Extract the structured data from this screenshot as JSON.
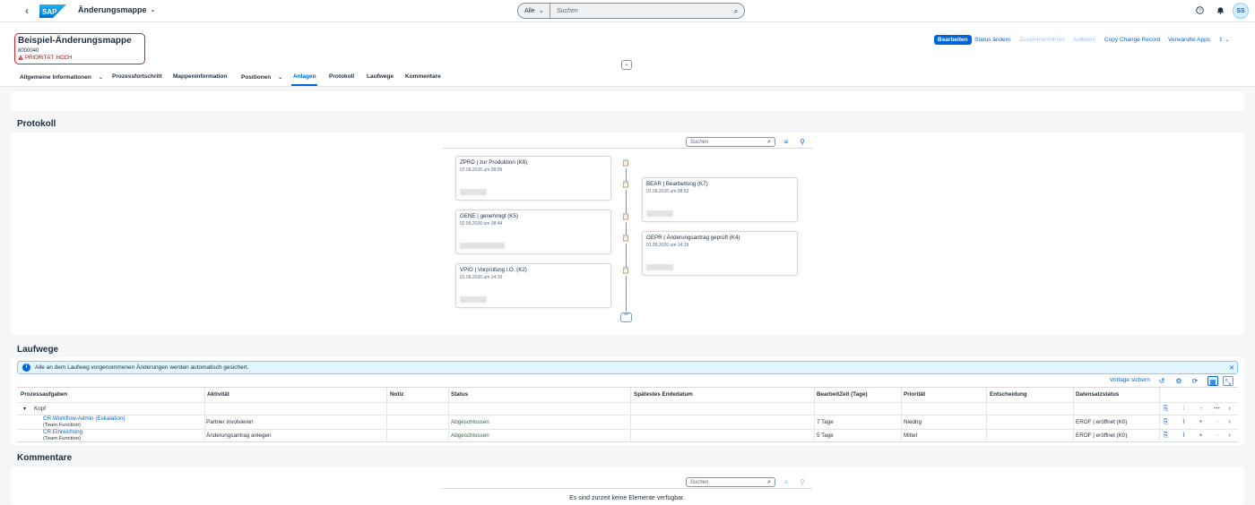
{
  "shell": {
    "back_icon": "arrow-left-icon",
    "logo": "SAP",
    "app_title": "Änderungsmappe",
    "search_scope": "Alle",
    "search_placeholder": "Suchen",
    "user_initials": "SS"
  },
  "header": {
    "title": "Beispiel-Änderungsmappe",
    "id": "8000040",
    "priority": "PRIORITÄT: HOCH",
    "actions": [
      "Bearbeiten",
      "Status ändern",
      "Zusammenführen",
      "Aufteilen",
      "Copy Change Record",
      "Verwandte Apps"
    ]
  },
  "tabs": [
    "Allgemeine Informationen",
    "Prozessfortschritt",
    "Mappeninformation",
    "Positionen",
    "Anlagen",
    "Protokoll",
    "Laufwege",
    "Kommentare"
  ],
  "active_tab": "Anlagen",
  "protokoll": {
    "title": "Protokoll",
    "search_placeholder": "Suchen",
    "entries": [
      {
        "title": "ZPRD | zur Produktion (K8)",
        "date": "07.09.2026 um 08:05"
      },
      {
        "title": "BEAR | Bearbeitung (K7)",
        "date": "02.09.2026 um 08:53"
      },
      {
        "title": "GENE | genehmigt (K5)",
        "date": "02.09.2026 um 08:44"
      },
      {
        "title": "GEPR | Änderungsantrag geprüft (K4)",
        "date": "01.09.2026 um 14:19"
      },
      {
        "title": "VPIO | Vorprüfung i.O. (K2)",
        "date": "01.09.2026 um 14:10"
      }
    ]
  },
  "laufwege": {
    "title": "Laufwege",
    "info": "Alle an dem Laufweg vorgenommenen Änderungen werden automatisch gesichert.",
    "save_template": "Vorlage sichern",
    "columns": [
      "Prozessaufgaben",
      "Aktivität",
      "Notiz",
      "Status",
      "Spätestes Endedatum",
      "BearbeitZeit (Tage)",
      "Priorität",
      "Entscheidung",
      "Datensatzstatus"
    ],
    "group": "Kopf",
    "rows": [
      {
        "task": "CR Workflow-Admin (Eskalation)",
        "task_sub": "(Team Function)",
        "activity": "Partner involvieren",
        "note": "",
        "status": "Abgeschlossen",
        "end": "",
        "days": "7 Tage",
        "priority": "Niedrig",
        "decision": "",
        "record_status": "EROF | eröffnet (K0)"
      },
      {
        "task": "CR Einreichung",
        "task_sub": "(Team Function)",
        "activity": "Änderungsantrag anlegen",
        "note": "",
        "status": "Abgeschlossen",
        "end": "",
        "days": "5 Tage",
        "priority": "Mittel",
        "decision": "",
        "record_status": "EROF | eröffnet (K0)"
      }
    ]
  },
  "kommentare": {
    "title": "Kommentare",
    "search_placeholder": "Suchen",
    "empty_text": "Es sind zurzeit keine Elemente verfügbar."
  },
  "colors": {
    "brand": "#0064d9",
    "error": "#d32030",
    "success": "#256f3a"
  }
}
